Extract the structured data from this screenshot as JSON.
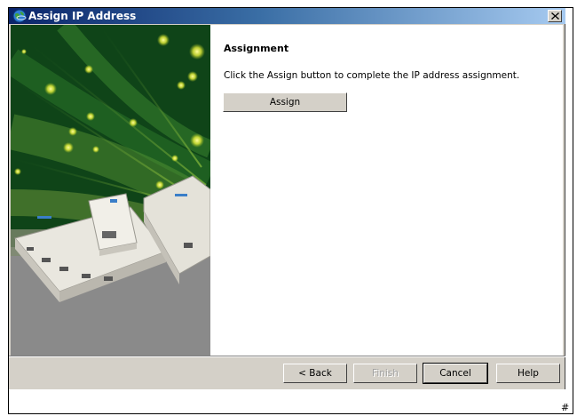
{
  "window": {
    "title": "Assign IP Address",
    "icon": "globe-icon"
  },
  "content": {
    "heading": "Assignment",
    "instruction": "Click the Assign button to complete the IP address assignment.",
    "assign_label": "Assign"
  },
  "buttons": {
    "back": "< Back",
    "finish": "Finish",
    "cancel": "Cancel",
    "help": "Help"
  },
  "footer_mark": "#",
  "colors": {
    "titlebar_start": "#0a246a",
    "titlebar_end": "#a6caf0",
    "dialog_face": "#d4d0c8"
  }
}
